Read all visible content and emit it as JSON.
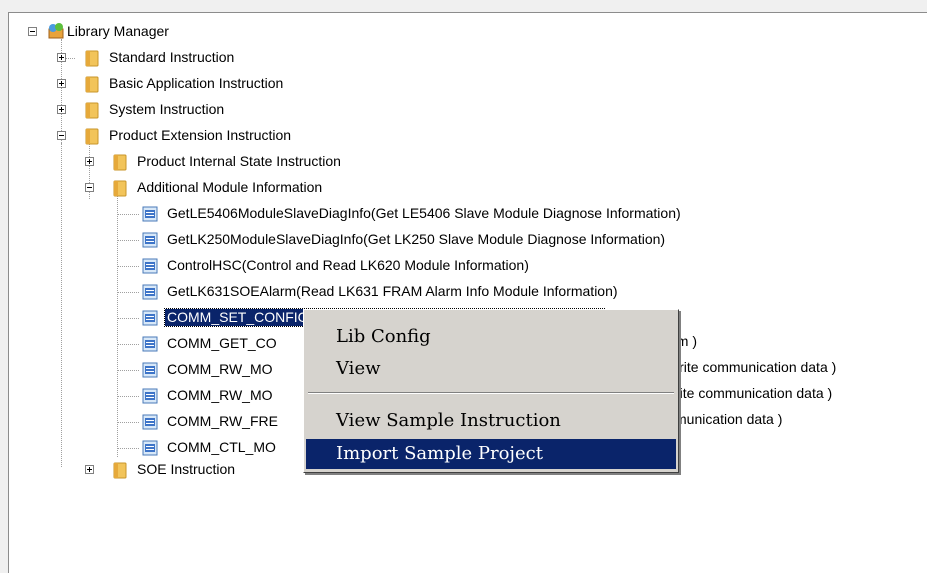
{
  "tree": {
    "root": "Library Manager",
    "standard": "Standard Instruction",
    "basic": "Basic Application Instruction",
    "system": "System Instruction",
    "product_ext": "Product Extension Instruction",
    "product_internal": "Product Internal State Instruction",
    "additional": "Additional Module Information",
    "items": [
      "GetLE5406ModuleSlaveDiagInfo(Get LE5406 Slave Module Diagnose Information)",
      "GetLK250ModuleSlaveDiagInfo(Get LK250 Slave Module Diagnose Information)",
      "ControlHSC(Control and Read LK620 Module Information)",
      "GetLK631SOEAlarm(Read LK631 FRAM Alarm Info Module Information)",
      "COMM_SET_CONFIG(Set LK238 Communication Instruction Param )",
      "COMM_GET_CO",
      "COMM_RW_MO",
      "COMM_RW_MO",
      "COMM_RW_FRE",
      "COMM_CTL_MO"
    ],
    "tails": [
      "am )",
      "write communication data )",
      "rite communication data )",
      "munication data )"
    ],
    "soe": "SOE Instruction"
  },
  "context_menu": {
    "items": [
      "Lib Config",
      "View",
      "View Sample Instruction",
      "Import Sample Project"
    ],
    "highlighted": "Import Sample Project"
  },
  "colors": {
    "selection": "#0a246a",
    "folder": "#f2c45a",
    "menu_bg": "#d6d3ce"
  }
}
